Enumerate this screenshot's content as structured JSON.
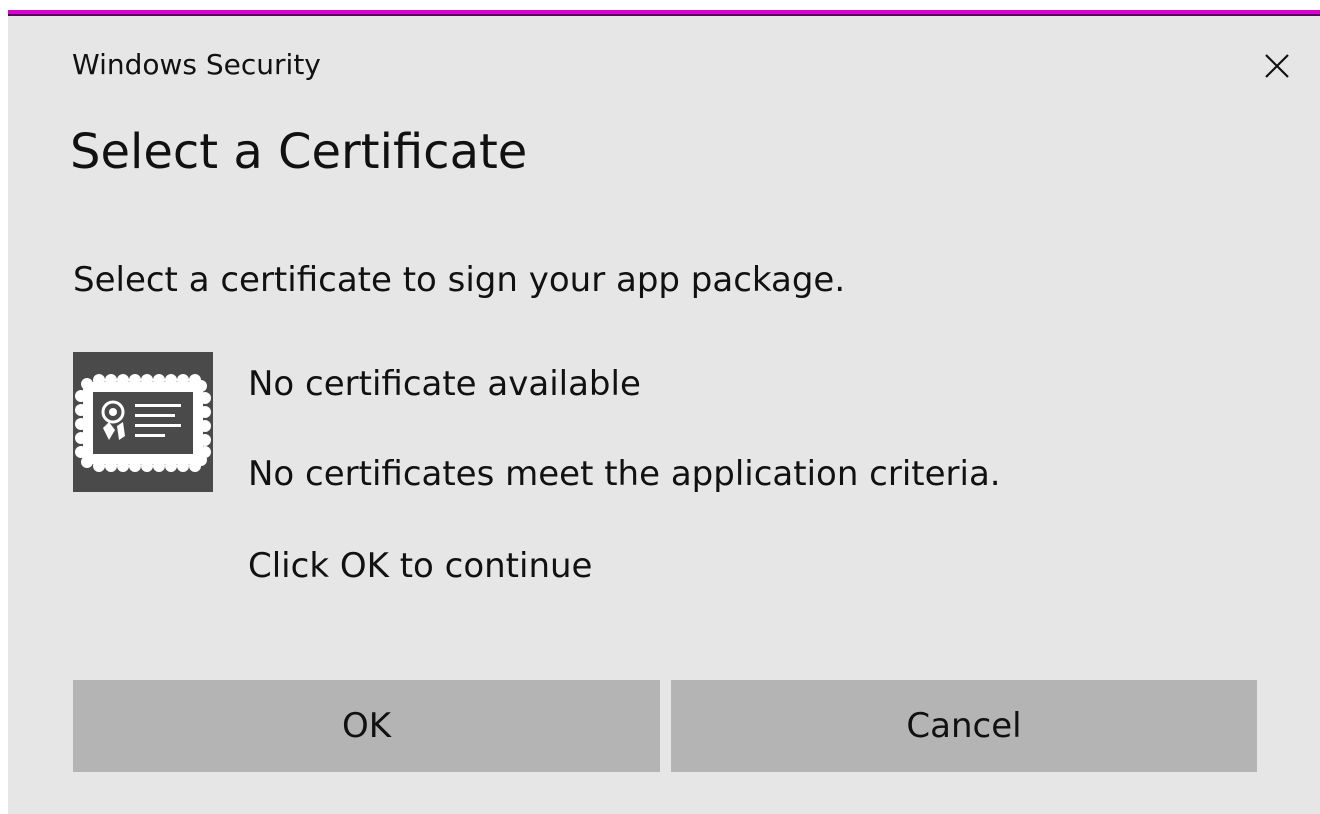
{
  "window": {
    "app_title": "Windows Security",
    "close_icon": "close-icon",
    "accent_color": "#d400d4"
  },
  "dialog": {
    "title": "Select a Certificate",
    "instruction": "Select a certificate to sign your app package."
  },
  "certificate": {
    "icon": "certificate-icon",
    "name": "No certificate available",
    "description": "No certificates meet the application criteria.",
    "hint": "Click OK to continue"
  },
  "buttons": {
    "ok_label": "OK",
    "cancel_label": "Cancel"
  },
  "colors": {
    "dialog_background": "#e6e6e6",
    "button_background": "#b4b4b4",
    "icon_background": "#4a4a4a"
  }
}
